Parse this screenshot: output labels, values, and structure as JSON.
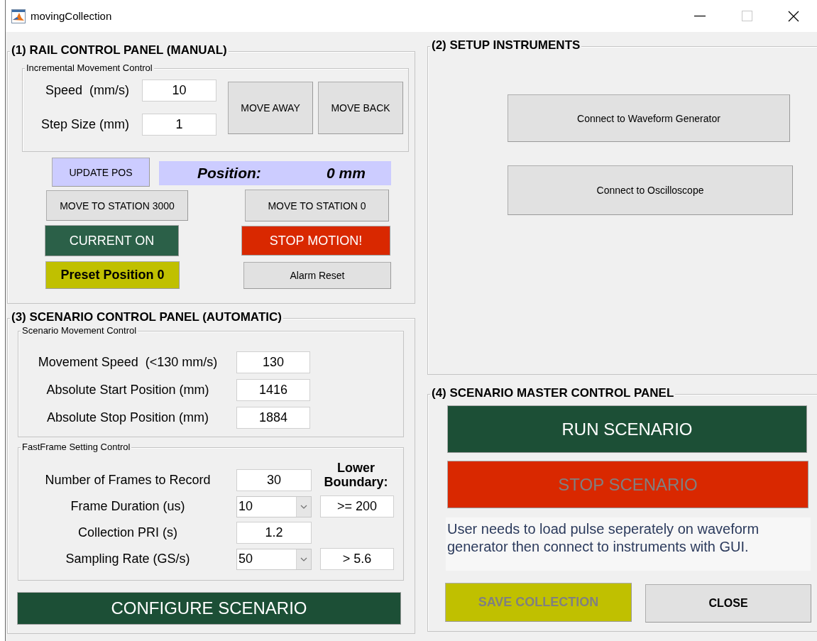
{
  "window": {
    "title": "movingCollection"
  },
  "rail_panel": {
    "title": "(1) RAIL CONTROL PANEL (MANUAL)",
    "incremental": {
      "title": "Incremental Movement Control",
      "fields": [
        {
          "label": "Speed  (mm/s)",
          "value": "10"
        },
        {
          "label": "Step Size (mm)",
          "value": "1"
        }
      ],
      "buttons": [
        {
          "label": "MOVE AWAY"
        },
        {
          "label": "MOVE BACK"
        }
      ]
    },
    "update_button": {
      "label": "UPDATE POS",
      "color": "#ccccff"
    },
    "position": {
      "label": "Position:",
      "value": "0 mm"
    },
    "buttons": [
      {
        "label": "MOVE TO STATION 3000"
      },
      {
        "label": "MOVE TO STATION 0"
      },
      {
        "label": "CURRENT ON",
        "color": "#2b6048"
      },
      {
        "label": "STOP MOTION!",
        "color": "#d92800"
      },
      {
        "label": "Preset Position 0",
        "color": "#c0c000"
      },
      {
        "label": "Alarm Reset"
      }
    ]
  },
  "instruments_panel": {
    "title": "(2) SETUP INSTRUMENTS",
    "buttons": [
      {
        "label": "Connect to Waveform Generator"
      },
      {
        "label": "Connect to Oscilloscope"
      }
    ]
  },
  "scenario_panel": {
    "title": "(3) SCENARIO CONTROL PANEL (AUTOMATIC)",
    "movement": {
      "title": "Scenario Movement Control",
      "fields": [
        {
          "label": "Movement Speed  (<130 mm/s)",
          "value": "130"
        },
        {
          "label": "Absolute Start Position (mm)",
          "value": "1416"
        },
        {
          "label": "Absolute Stop Position (mm)",
          "value": "1884"
        }
      ]
    },
    "fastframe": {
      "title": "FastFrame Setting Control",
      "boundary_heading": "Lower Boundary:",
      "rows": [
        {
          "label": "Number of Frames to Record",
          "kind": "edit",
          "value": "30"
        },
        {
          "label": "Frame Duration (us)",
          "kind": "dropdown",
          "value": "10",
          "bound": ">= 200"
        },
        {
          "label": "Collection PRI (s)",
          "kind": "edit",
          "value": "1.2"
        },
        {
          "label": "Sampling Rate (GS/s)",
          "kind": "dropdown",
          "value": "50",
          "bound": "> 5.6"
        }
      ]
    },
    "configure_button": {
      "label": "CONFIGURE SCENARIO",
      "color": "#1c4f36"
    }
  },
  "master_panel": {
    "title": "(4) SCENARIO MASTER CONTROL PANEL",
    "buttons": [
      {
        "label": "RUN SCENARIO",
        "color": "#1c4f36",
        "disabled": false
      },
      {
        "label": "STOP SCENARIO",
        "color": "#d92800",
        "disabled": true
      }
    ],
    "note": "User needs to load pulse seperately on waveform generator then connect to instruments with GUI.",
    "footer_buttons": [
      {
        "label": "SAVE COLLECTION",
        "color": "#c0c000",
        "disabled": true
      },
      {
        "label": "CLOSE",
        "disabled": false
      }
    ]
  }
}
